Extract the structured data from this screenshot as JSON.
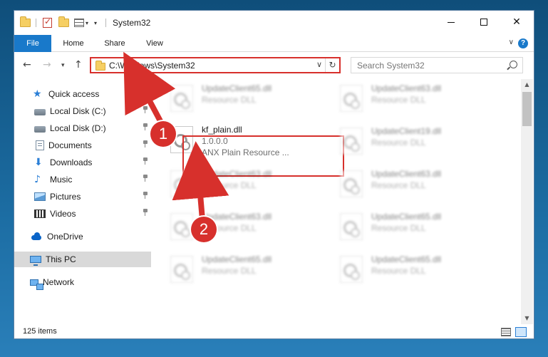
{
  "window": {
    "title": "System32"
  },
  "ribbon": {
    "tabs": [
      "File",
      "Home",
      "Share",
      "View"
    ]
  },
  "navigation": {
    "address": "C:\\Windows\\System32",
    "search_placeholder": "Search System32"
  },
  "sidebar": {
    "items": [
      {
        "label": "Quick access",
        "icon": "star-icon"
      },
      {
        "label": "Local Disk (C:)",
        "icon": "disk-icon",
        "pinned": true
      },
      {
        "label": "Local Disk (D:)",
        "icon": "disk-icon",
        "pinned": true
      },
      {
        "label": "Documents",
        "icon": "documents-icon",
        "pinned": true
      },
      {
        "label": "Downloads",
        "icon": "downloads-icon",
        "pinned": true
      },
      {
        "label": "Music",
        "icon": "music-icon",
        "pinned": true
      },
      {
        "label": "Pictures",
        "icon": "pictures-icon",
        "pinned": true
      },
      {
        "label": "Videos",
        "icon": "videos-icon",
        "pinned": true
      },
      {
        "label": "OneDrive",
        "icon": "cloud-icon"
      },
      {
        "label": "This PC",
        "icon": "pc-icon",
        "selected": true
      },
      {
        "label": "Network",
        "icon": "network-icon"
      }
    ]
  },
  "files": {
    "highlighted": {
      "name": "kf_plain.dll",
      "version": "1.0.0.0",
      "description": "ANX Plain Resource ..."
    },
    "blurred": [
      {
        "name": "UpdateClient65.dll",
        "type": "Resource DLL"
      },
      {
        "name": "UpdateClient63.dll",
        "type": "Resource DLL"
      },
      {
        "name": "UpdateClient19.dll",
        "type": "Resource DLL"
      },
      {
        "name": "UpdateClient63.dll",
        "type": "Resource DLL"
      },
      {
        "name": "UpdateClient63.dll",
        "type": "Resource DLL"
      },
      {
        "name": "UpdateClient63.dll",
        "type": "Resource DLL"
      },
      {
        "name": "UpdateClient63.dll",
        "type": "Resource DLL"
      },
      {
        "name": "UpdateClient65.dll",
        "type": "Resource DLL"
      },
      {
        "name": "UpdateClient65.dll",
        "type": "Resource DLL"
      },
      {
        "name": "UpdateClient65.dll",
        "type": "Resource DLL"
      }
    ]
  },
  "status": {
    "item_count": "125 items"
  },
  "callouts": {
    "step1": "1",
    "step2": "2"
  },
  "colors": {
    "accent": "#1979ca",
    "highlight": "#d7302c",
    "selected_bg": "#d9d9d9"
  }
}
